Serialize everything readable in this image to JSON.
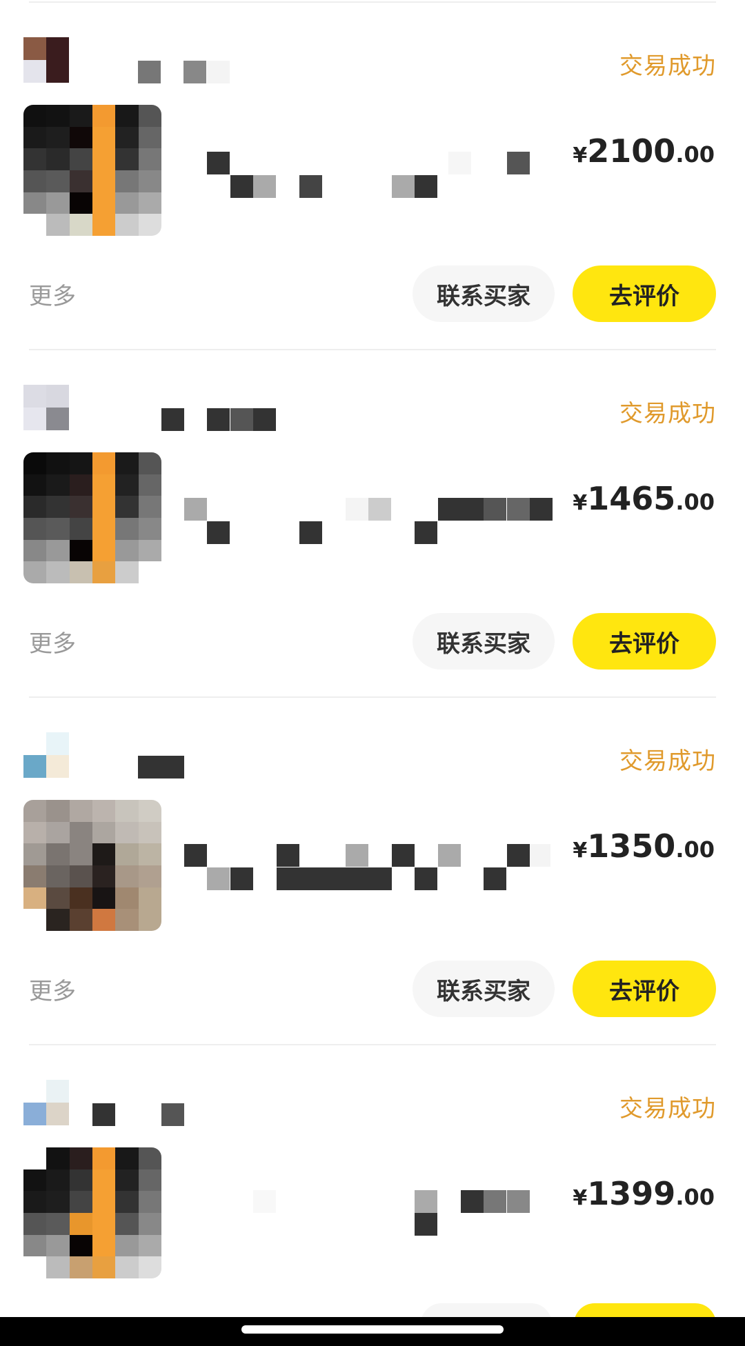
{
  "orders": [
    {
      "status": "交易成功",
      "currency": "¥",
      "price_int": "2100",
      "price_dec": ".00",
      "more_label": "更多",
      "contact_label": "联系买家",
      "review_label": "去评价"
    },
    {
      "status": "交易成功",
      "currency": "¥",
      "price_int": "1465",
      "price_dec": ".00",
      "more_label": "更多",
      "contact_label": "联系买家",
      "review_label": "去评价"
    },
    {
      "status": "交易成功",
      "currency": "¥",
      "price_int": "1350",
      "price_dec": ".00",
      "more_label": "更多",
      "contact_label": "联系买家",
      "review_label": "去评价"
    },
    {
      "status": "交易成功",
      "currency": "¥",
      "price_int": "1399",
      "price_dec": ".00"
    }
  ],
  "colors": {
    "status": "#e09a2c",
    "review_button": "#ffe60f",
    "contact_button": "#f6f6f6"
  }
}
